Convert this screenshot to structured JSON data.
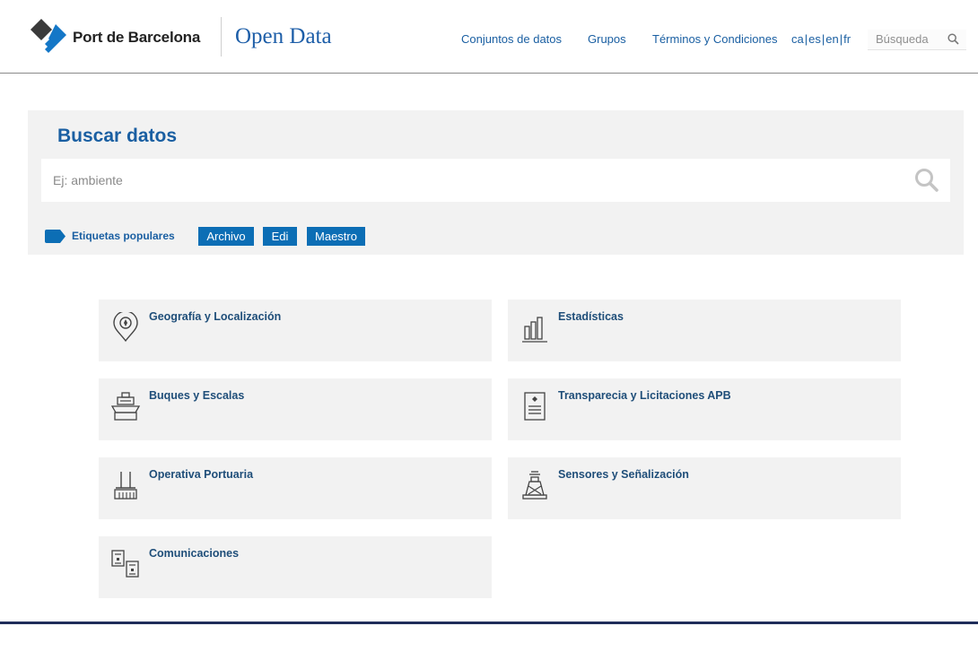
{
  "header": {
    "brand": "Port de Barcelona",
    "product": "Open Data",
    "nav": [
      "Conjuntos de datos",
      "Grupos",
      "Términos y Condiciones"
    ],
    "languages": [
      "ca",
      "es",
      "en",
      "fr"
    ],
    "search_placeholder": "Búsqueda"
  },
  "search_panel": {
    "title": "Buscar datos",
    "placeholder": "Ej: ambiente",
    "popular_tags_label": "Etiquetas populares",
    "tags": [
      "Archivo",
      "Edi",
      "Maestro"
    ]
  },
  "categories": [
    {
      "label": "Geografía y Localización",
      "icon": "map-pin-icon"
    },
    {
      "label": "Estadísticas",
      "icon": "bar-chart-icon"
    },
    {
      "label": "Buques y Escalas",
      "icon": "ship-icon"
    },
    {
      "label": "Transparecia y Licitaciones APB",
      "icon": "document-icon"
    },
    {
      "label": "Operativa Portuaria",
      "icon": "crane-icon"
    },
    {
      "label": "Sensores y Señalización",
      "icon": "beacon-icon"
    },
    {
      "label": "Comunicaciones",
      "icon": "communications-icon"
    }
  ],
  "colors": {
    "accent": "#1a5fa2",
    "tag_bg": "#0c6eb5",
    "panel_bg": "#f2f2f2",
    "card_title": "#1f4e79",
    "footer_line": "#1f2d5a"
  }
}
